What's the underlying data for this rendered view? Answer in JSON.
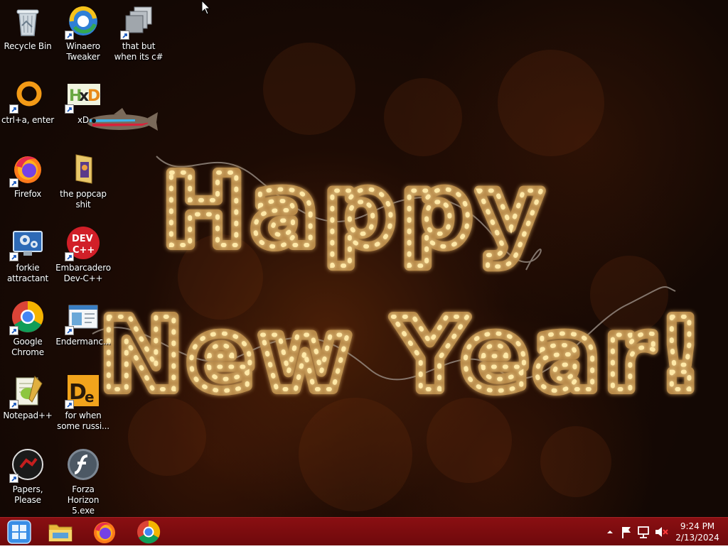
{
  "desktop": {
    "wallpaper": {
      "line1": "Happy",
      "line2": "New Year!",
      "light_color": "#ffe9a8"
    },
    "icons": [
      {
        "id": "recycle-bin",
        "label": "Recycle Bin",
        "icon": "recycle-bin-icon",
        "shortcut": false
      },
      {
        "id": "winaero-tweaker",
        "label": "Winaero Tweaker",
        "icon": "winaero-tweaker-icon",
        "shortcut": true
      },
      {
        "id": "that-but-when",
        "label": "that but when its c#",
        "icon": "windows-stack-icon",
        "shortcut": true
      },
      {
        "id": "ctrl-a-enter",
        "label": "ctrl+a, enter",
        "icon": "orange-ring-icon",
        "shortcut": true
      },
      {
        "id": "xd",
        "label": "xD",
        "icon": "hxd-icon",
        "shortcut": true
      },
      {
        "id": "firefox",
        "label": "Firefox",
        "icon": "firefox-icon",
        "shortcut": true
      },
      {
        "id": "popcap",
        "label": "the popcap shit",
        "icon": "folder-icon",
        "shortcut": false
      },
      {
        "id": "forkie",
        "label": "forkie attractant",
        "icon": "monitor-gear-icon",
        "shortcut": true
      },
      {
        "id": "devcpp",
        "label": "Embarcadero Dev-C++",
        "icon": "devcpp-icon",
        "shortcut": true
      },
      {
        "id": "chrome",
        "label": "Google Chrome",
        "icon": "chrome-icon",
        "shortcut": true
      },
      {
        "id": "endermanch",
        "label": "Endermanc...",
        "icon": "window-app-icon",
        "shortcut": true
      },
      {
        "id": "notepadpp",
        "label": "Notepad++",
        "icon": "notepadpp-icon",
        "shortcut": true
      },
      {
        "id": "for-when",
        "label": "for when some russi...",
        "icon": "de-icon",
        "shortcut": true
      },
      {
        "id": "papers-please",
        "label": "Papers, Please",
        "icon": "papers-please-icon",
        "shortcut": true
      },
      {
        "id": "forza",
        "label": "Forza Horizon 5.exe",
        "icon": "flash-icon",
        "shortcut": false
      }
    ]
  },
  "taskbar": {
    "pinned": [
      {
        "id": "start",
        "icon": "windows-start-icon"
      },
      {
        "id": "explorer",
        "icon": "file-explorer-icon"
      },
      {
        "id": "firefox",
        "icon": "firefox-icon"
      },
      {
        "id": "chrome",
        "icon": "chrome-icon"
      }
    ],
    "tray": {
      "icons": [
        "show-hidden-icons-chevron",
        "action-center-flag-icon",
        "network-icon",
        "volume-muted-icon"
      ],
      "time": "9:24 PM",
      "date": "2/13/2024"
    },
    "color": "#7d0c10"
  }
}
